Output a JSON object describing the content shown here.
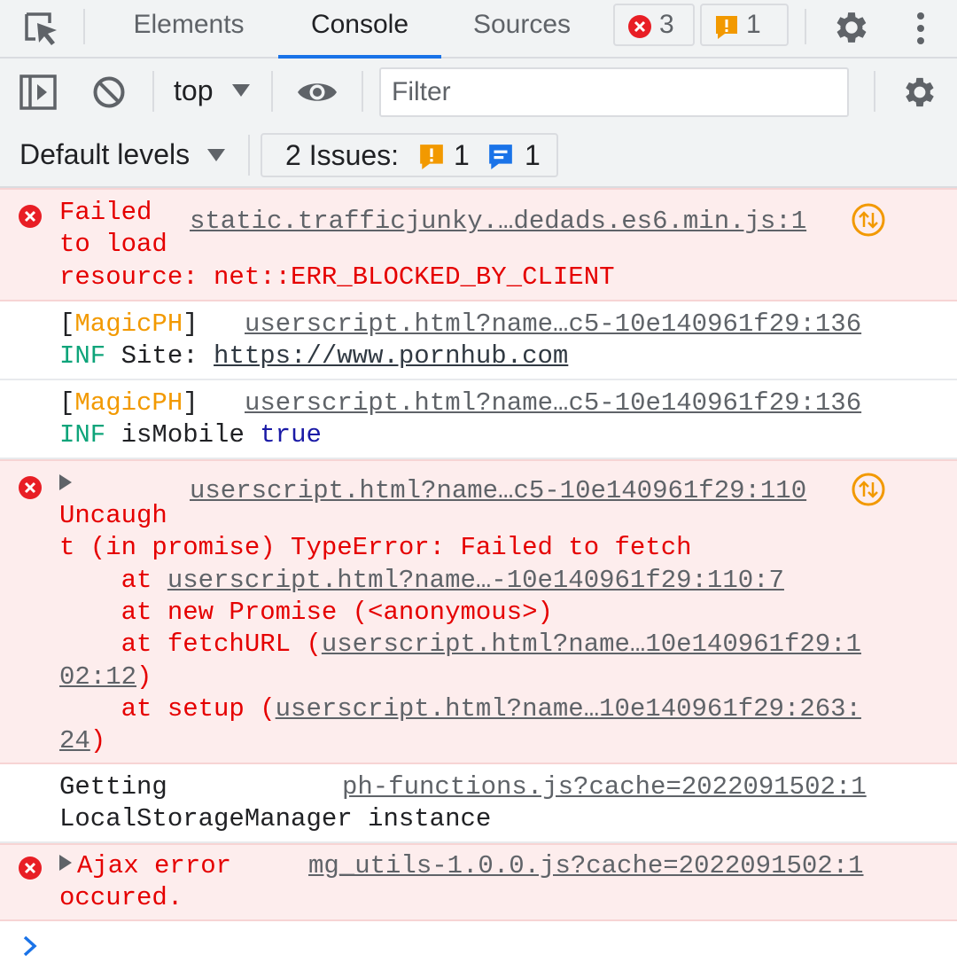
{
  "tabs": {
    "elements": "Elements",
    "console": "Console",
    "sources": "Sources",
    "error_count": "3",
    "warning_count": "1"
  },
  "toolbar": {
    "context": "top",
    "filter_placeholder": "Filter",
    "levels": "Default levels",
    "issues_label": "2 Issues:",
    "issues_warning_count": "1",
    "issues_info_count": "1"
  },
  "colors": {
    "error": "#e50000",
    "warning_badge": "#f29900",
    "accent": "#1a73e8",
    "tag": "#f29900",
    "level": "#0ea47a"
  },
  "messages": [
    {
      "type": "error",
      "text_lines": [
        "Failed",
        "to load",
        "resource: net::ERR_BLOCKED_BY_CLIENT"
      ],
      "source": "static.trafficjunky.…dedads.es6.min.js:1"
    },
    {
      "type": "log",
      "tag": "MagicPH",
      "level": "INF",
      "label": "Site:",
      "value": "https://www.pornhub.com",
      "source": "userscript.html?name…c5-10e140961f29:136"
    },
    {
      "type": "log",
      "tag": "MagicPH",
      "level": "INF",
      "label": "isMobile",
      "value": "true",
      "source": "userscript.html?name…c5-10e140961f29:136"
    },
    {
      "type": "error",
      "source": "userscript.html?name…c5-10e140961f29:110",
      "text_lines": [
        "Uncaugh",
        "t (in promise) TypeError: Failed to fetch",
        "    at ",
        "    at new Promise (<anonymous>)",
        "    at fetchURL (",
        ")",
        "    at setup (",
        ")"
      ],
      "stack_links": [
        "userscript.html?name…-10e140961f29:110:7",
        "userscript.html?name…10e140961f29:1",
        "02:12",
        "userscript.html?name…10e140961f29:263:",
        "24"
      ]
    },
    {
      "type": "log",
      "text_lines": [
        "Getting",
        "LocalStorageManager instance"
      ],
      "source": "ph-functions.js?cache=2022091502:1"
    },
    {
      "type": "error",
      "text_lines": [
        "Ajax error",
        "occured."
      ],
      "source": "mg_utils-1.0.0.js?cache=2022091502:1"
    }
  ],
  "icons": {
    "inspect": "inspect-element-icon",
    "settings": "gear-icon",
    "more": "kebab-menu-icon",
    "sidebar": "sidebar-toggle-icon",
    "clear": "clear-console-icon",
    "eye": "live-expression-icon",
    "error": "error-circle-icon",
    "warning": "warning-square-icon",
    "info": "info-message-icon",
    "expand": "expand-triangle-icon",
    "pull": "request-arrows-icon",
    "prompt": "chevron-right-icon"
  }
}
